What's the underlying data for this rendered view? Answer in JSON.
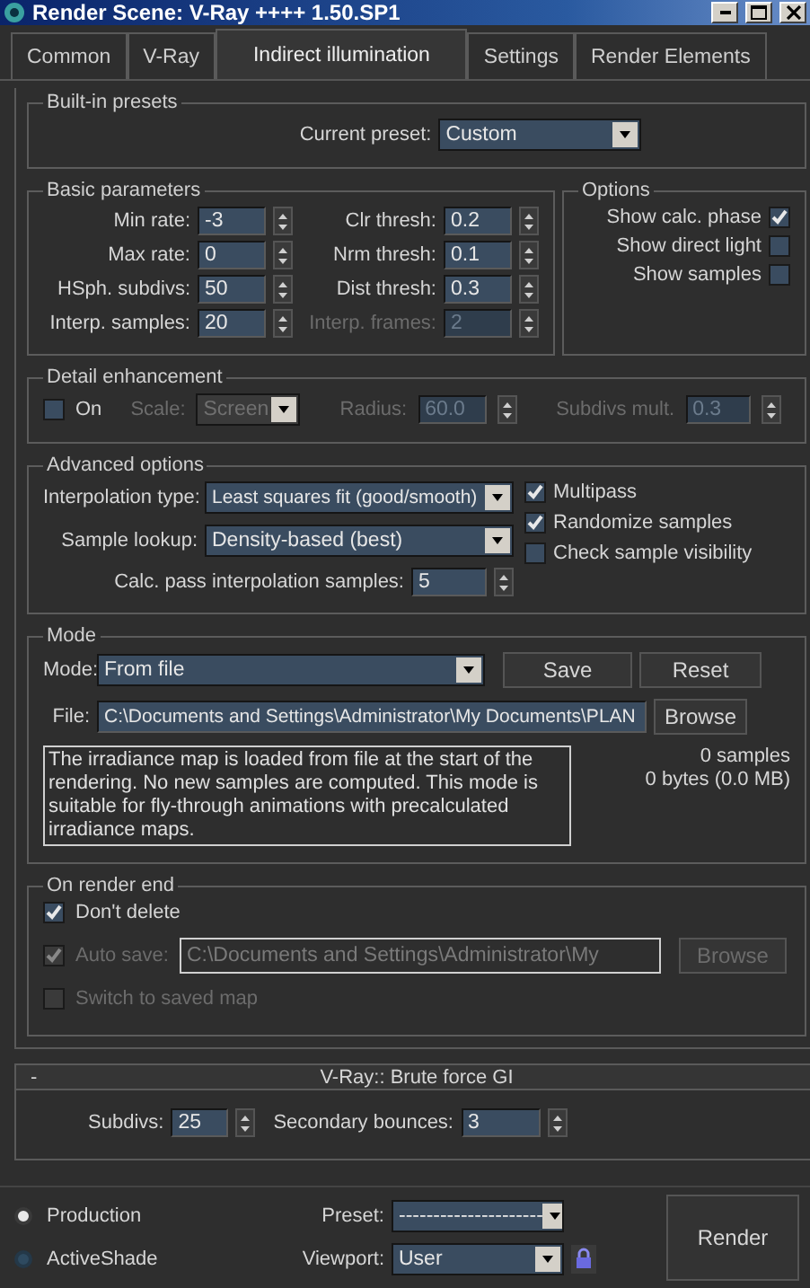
{
  "window": {
    "title": "Render Scene: V-Ray ++++ 1.50.SP1"
  },
  "tabs": [
    {
      "label": "Common",
      "selected": false
    },
    {
      "label": "V-Ray",
      "selected": false
    },
    {
      "label": "Indirect illumination",
      "selected": true
    },
    {
      "label": "Settings",
      "selected": false
    },
    {
      "label": "Render Elements",
      "selected": false
    }
  ],
  "presets": {
    "title": "Built-in presets",
    "label": "Current preset:",
    "value": "Custom"
  },
  "basic": {
    "title": "Basic parameters",
    "left": [
      {
        "label": "Min rate:",
        "value": "-3",
        "disabled": false
      },
      {
        "label": "Max rate:",
        "value": "0",
        "disabled": false
      },
      {
        "label": "HSph. subdivs:",
        "value": "50",
        "disabled": false
      },
      {
        "label": "Interp. samples:",
        "value": "20",
        "disabled": false
      }
    ],
    "right": [
      {
        "label": "Clr thresh:",
        "value": "0.2",
        "disabled": false
      },
      {
        "label": "Nrm thresh:",
        "value": "0.1",
        "disabled": false
      },
      {
        "label": "Dist thresh:",
        "value": "0.3",
        "disabled": false
      },
      {
        "label": "Interp. frames:",
        "value": "2",
        "disabled": true
      }
    ]
  },
  "options": {
    "title": "Options",
    "items": [
      {
        "label": "Show calc. phase",
        "checked": true
      },
      {
        "label": "Show direct light",
        "checked": false
      },
      {
        "label": "Show samples",
        "checked": false
      }
    ]
  },
  "detail": {
    "title": "Detail enhancement",
    "on": {
      "label": "On",
      "checked": false
    },
    "scale": {
      "label": "Scale:",
      "value": "Screen",
      "disabled": true
    },
    "radius": {
      "label": "Radius:",
      "value": "60.0",
      "disabled": true
    },
    "subdivs_mult": {
      "label": "Subdivs mult.",
      "value": "0.3",
      "disabled": true
    }
  },
  "advanced": {
    "title": "Advanced options",
    "interpolation": {
      "label": "Interpolation type:",
      "value": "Least squares fit (good/smooth)"
    },
    "lookup": {
      "label": "Sample lookup:",
      "value": "Density-based (best)"
    },
    "calc": {
      "label": "Calc. pass interpolation samples:",
      "value": "5"
    },
    "checks": [
      {
        "label": "Multipass",
        "checked": true
      },
      {
        "label": "Randomize samples",
        "checked": true
      },
      {
        "label": "Check sample visibility",
        "checked": false
      }
    ]
  },
  "mode": {
    "title": "Mode",
    "label": "Mode:",
    "value": "From file",
    "buttons": [
      "Save",
      "Reset"
    ],
    "file_label": "File:",
    "file": "C:\\Documents and Settings\\Administrator\\My Documents\\PLAN",
    "browse": "Browse",
    "description": "The irradiance map is loaded from file at the start of the rendering. No new samples are computed. This mode is suitable for fly-through animations with precalculated irradiance maps.",
    "stats": [
      "0 samples",
      "0 bytes (0.0 MB)"
    ]
  },
  "render_end": {
    "title": "On render end",
    "dont_delete": {
      "label": "Don't delete",
      "checked": true,
      "disabled": false
    },
    "auto_save": {
      "label": "Auto save:",
      "checked": true,
      "disabled": true,
      "value": "C:\\Documents and Settings\\Administrator\\My",
      "browse": "Browse"
    },
    "switch": {
      "label": "Switch to saved map",
      "checked": false,
      "disabled": true
    }
  },
  "brute": {
    "toggle": "-",
    "title": "V-Ray:: Brute force GI",
    "subdivs": {
      "label": "Subdivs:",
      "value": "25"
    },
    "bounces": {
      "label": "Secondary bounces:",
      "value": "3"
    }
  },
  "bottom": {
    "targets": [
      {
        "label": "Production",
        "selected": true
      },
      {
        "label": "ActiveShade",
        "selected": false
      }
    ],
    "preset": {
      "label": "Preset:",
      "value": "---------------------"
    },
    "viewport": {
      "label": "Viewport:",
      "value": "User"
    },
    "render": "Render"
  }
}
